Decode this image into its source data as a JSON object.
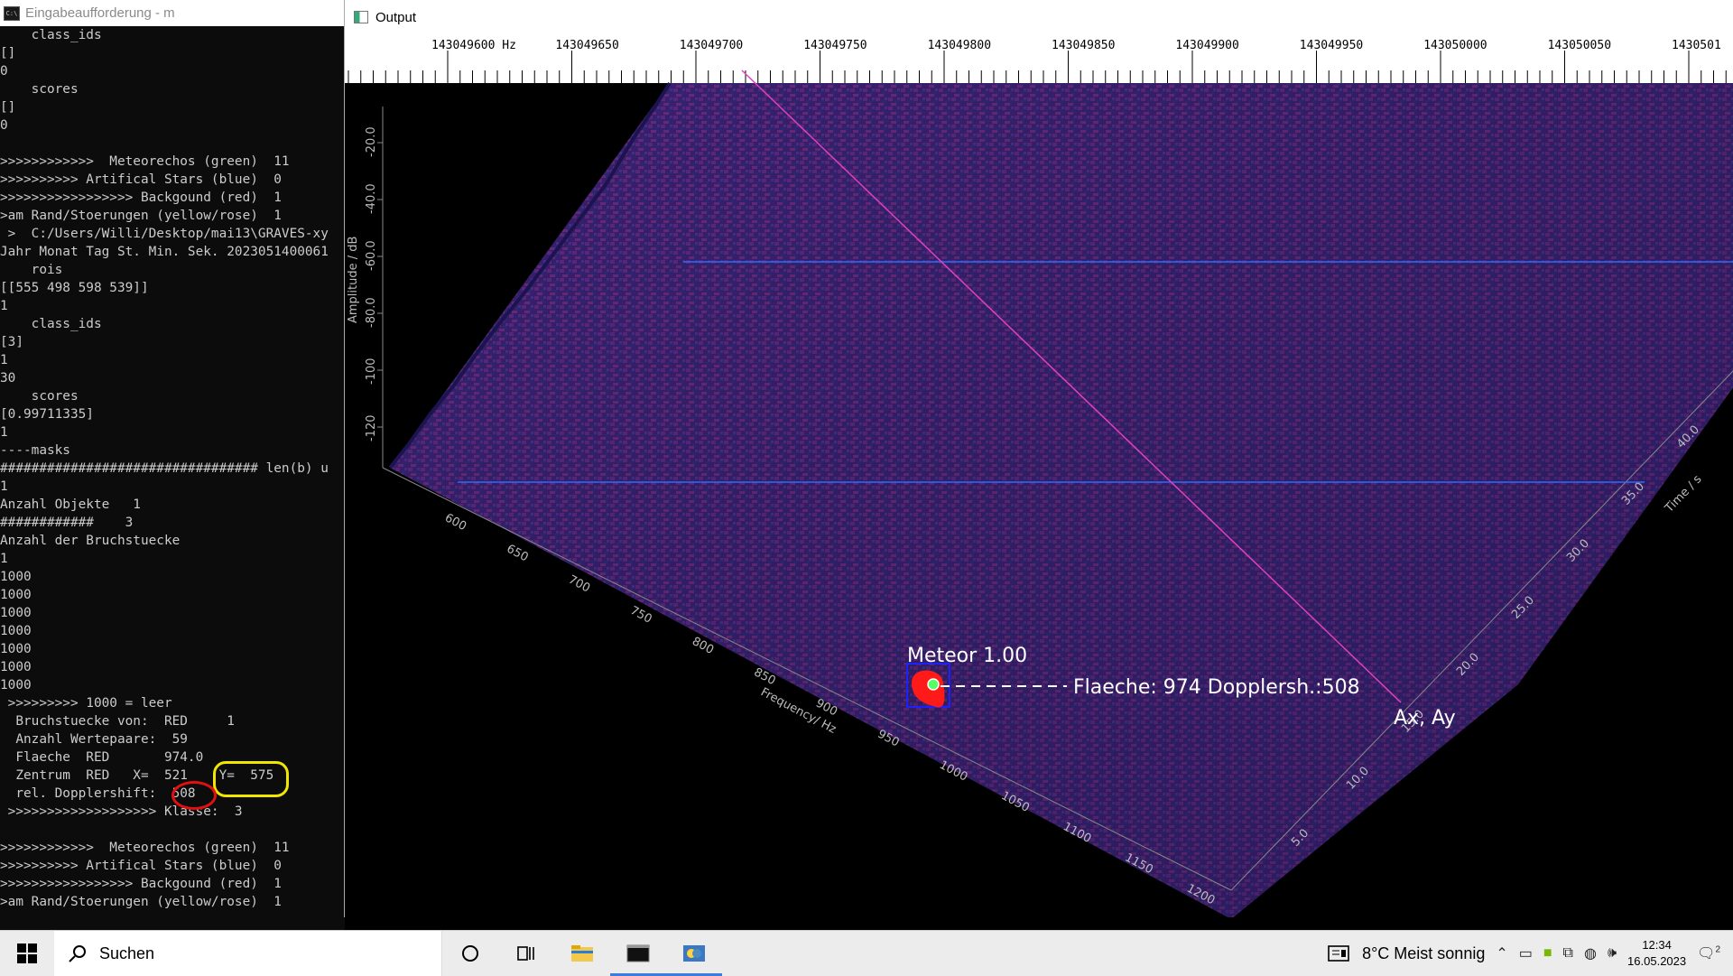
{
  "console": {
    "title": "Eingabeaufforderung - m",
    "lines": [
      "    class_ids",
      "[]",
      "0",
      "    scores",
      "[]",
      "0",
      "",
      ">>>>>>>>>>>>  Meteorechos (green)  11",
      ">>>>>>>>>> Artifical Stars (blue)  0",
      ">>>>>>>>>>>>>>>>> Backgound (red)  1",
      ">am Rand/Stoerungen (yellow/rose)  1",
      " >  C:/Users/Willi/Desktop/mai13\\GRAVES-xy",
      "Jahr Monat Tag St. Min. Sek. 2023051400061",
      "    rois",
      "[[555 498 598 539]]",
      "1",
      "    class_ids",
      "[3]",
      "1",
      "30",
      "    scores",
      "[0.99711335]",
      "1",
      "----masks",
      "################################# len(b) u",
      "1",
      "Anzahl Objekte   1",
      "############    3",
      "Anzahl der Bruchstuecke",
      "1",
      "1000",
      "1000",
      "1000",
      "1000",
      "1000",
      "1000",
      "1000",
      " >>>>>>>>> 1000 = leer",
      "  Bruchstuecke von:  RED     1",
      "  Anzahl Wertepaare:  59",
      "  Flaeche  RED       974.0",
      "  Zentrum  RED   X=  521    Y=  575",
      "  rel. Dopplershift:  508",
      " >>>>>>>>>>>>>>>>>>> Klasse:  3",
      "",
      ">>>>>>>>>>>>  Meteorechos (green)  11",
      ">>>>>>>>>> Artifical Stars (blue)  0",
      ">>>>>>>>>>>>>>>>> Backgound (red)  1",
      ">am Rand/Stoerungen (yellow/rose)  1"
    ]
  },
  "output": {
    "title": "Output",
    "freq_ticks": [
      "143049600 Hz",
      "143049650",
      "143049700",
      "143049750",
      "143049800",
      "143049850",
      "143049900",
      "143049950",
      "143050000",
      "143050050",
      "1430501"
    ],
    "amp_label": "Amplitude / dB",
    "amp_ticks": [
      "-20.0",
      "-40.0",
      "-60.0",
      "-80.0",
      "-100",
      "-120"
    ],
    "freq_label": "Frequency/ Hz",
    "freq_axis_ticks": [
      "600",
      "650",
      "700",
      "750",
      "800",
      "850",
      "900",
      "950",
      "1000",
      "1050",
      "1100",
      "1150",
      "1200"
    ],
    "time_label": "Time / s",
    "time_ticks": [
      "5.0",
      "10.0",
      "15.0",
      "20.0",
      "25.0",
      "30.0",
      "35.0",
      "40.0"
    ],
    "meteor_label": "Meteor  1.00",
    "flaeche_label": "Flaeche:   974  Dopplersh.:508",
    "ax_ay_label": "Ax, Ay",
    "colors": {
      "surface": "#3a1f6e",
      "meteor": "#ff1a1a",
      "box": "#2020ff",
      "line_blue": "#2a6cff",
      "line_pink": "#e040c0"
    }
  },
  "taskbar": {
    "search_placeholder": "Suchen",
    "weather": "8°C  Meist sonnig",
    "time": "12:34",
    "date": "16.05.2023",
    "notifications": "2"
  }
}
